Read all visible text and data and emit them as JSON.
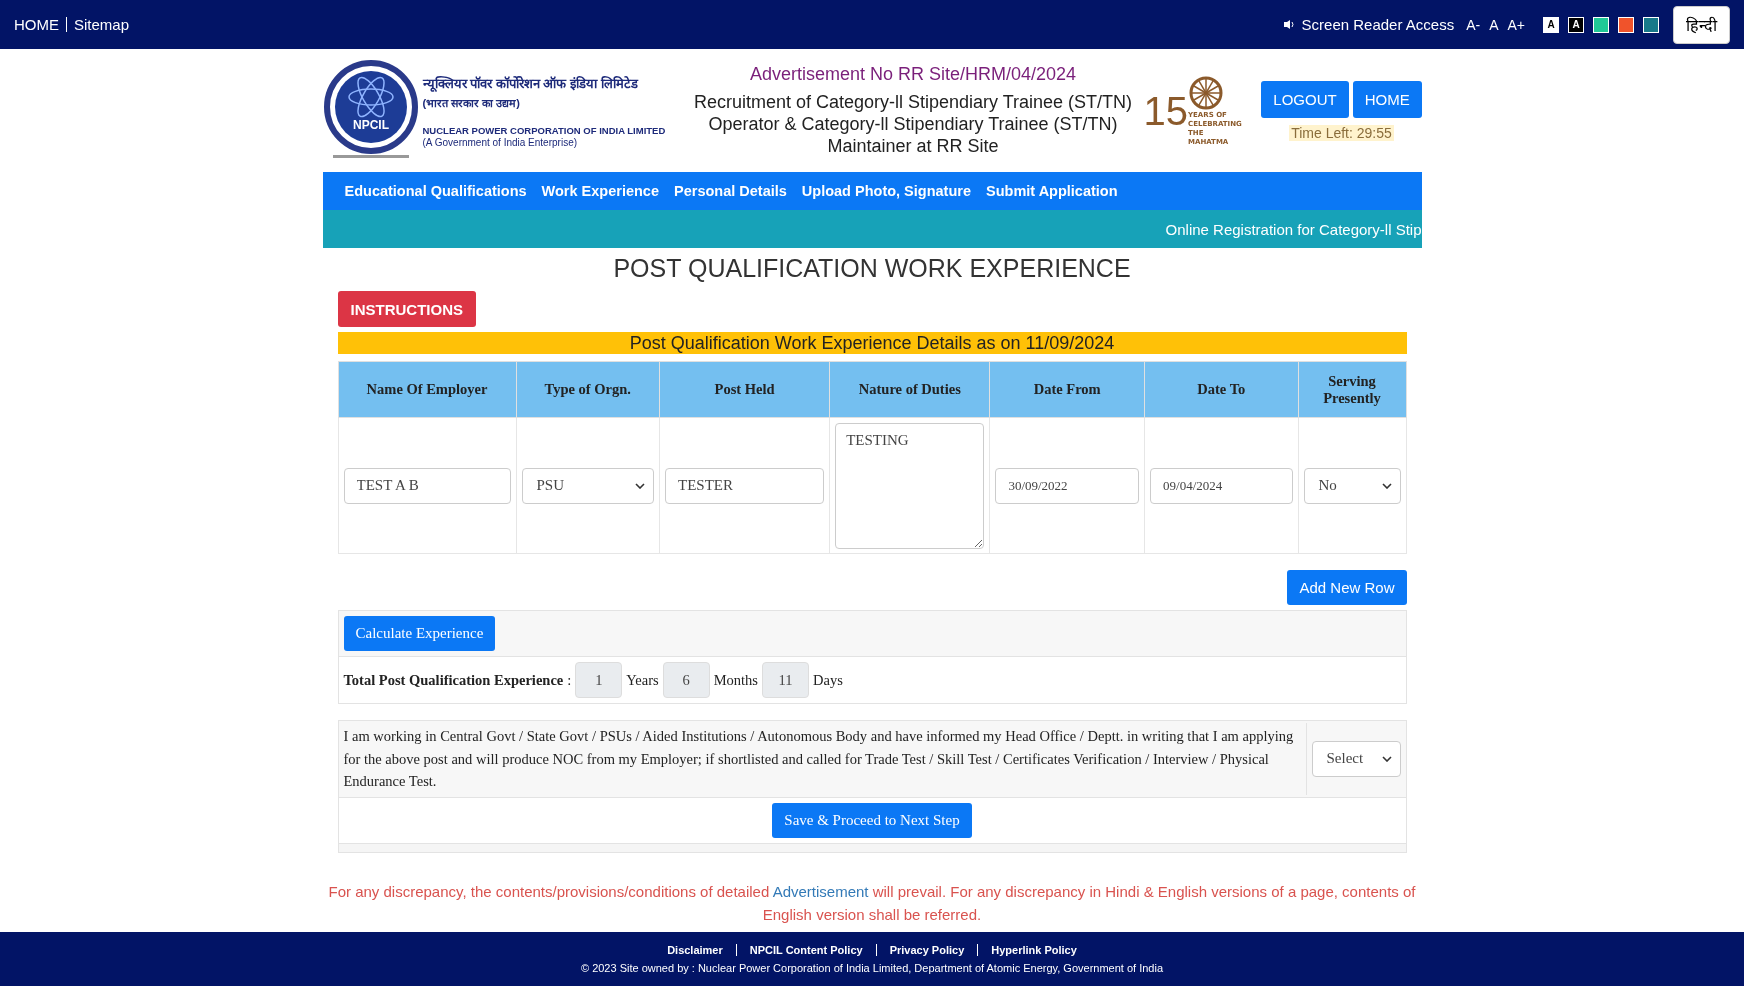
{
  "top_bar": {
    "links": [
      "HOME",
      "Sitemap"
    ],
    "screen_reader": "Screen Reader Access",
    "font_sizes": [
      "A-",
      "A",
      "A+"
    ],
    "themes": [
      {
        "label": "A",
        "color": "#ffffff"
      },
      {
        "label": "A",
        "color": "#000000"
      },
      {
        "color": "#20c997"
      },
      {
        "color": "#f0532b"
      },
      {
        "color": "#17798a"
      }
    ],
    "language": "हिन्दी"
  },
  "header": {
    "logo_text": "NPCIL",
    "org_hindi": "न्यूक्लियर पॉवर कॉर्पोरेशन ऑफ इंडिया लिमिटेड",
    "org_hindi_sub": "(भारत सरकार का उद्यम)",
    "org_english": "NUCLEAR POWER CORPORATION OF INDIA LIMITED",
    "org_english_sub": "(A Government of India Enterprise)",
    "advertisement": "Advertisement No RR Site/HRM/04/2024",
    "recruitment_lines": [
      "Recruitment of Category-ll Stipendiary Trainee (ST/TN)",
      "Operator & Category-ll Stipendiary Trainee (ST/TN)",
      "Maintainer at RR Site"
    ],
    "anniversary_number": "15",
    "anniversary_text": "YEARS OF CELEBRATING THE MAHATMA",
    "buttons": [
      "LOGOUT",
      "HOME"
    ],
    "time_left": "Time Left: 29:55"
  },
  "nav": [
    "Educational Qualifications",
    "Work Experience",
    "Personal Details",
    "Upload Photo, Signature",
    "Submit Application"
  ],
  "marquee": "Online Registration for Category-ll Stip",
  "page_title": "POST QUALIFICATION WORK EXPERIENCE",
  "instructions_button": "INSTRUCTIONS",
  "details_banner": "Post Qualification Work Experience Details as on 11/09/2024",
  "table": {
    "columns": [
      "Name Of Employer",
      "Type of Orgn.",
      "Post Held",
      "Nature of Duties",
      "Date From",
      "Date To",
      "Serving Presently"
    ],
    "rows": [
      [
        {
          "kind": "input",
          "value": "TEST A B"
        },
        {
          "kind": "select",
          "value": "PSU"
        },
        {
          "kind": "input",
          "value": "TESTER"
        },
        {
          "kind": "textarea",
          "value": "TESTING"
        },
        {
          "kind": "date",
          "value": "30/09/2022"
        },
        {
          "kind": "date",
          "value": "09/04/2024"
        },
        {
          "kind": "select",
          "value": "No"
        }
      ]
    ]
  },
  "add_row_button": "Add New Row",
  "calculate_button": "Calculate Experience",
  "total": {
    "label": "Total Post Qualification Experience",
    "separator": ":",
    "parts": [
      {
        "value": "1",
        "unit": "Years"
      },
      {
        "value": "6",
        "unit": "Months"
      },
      {
        "value": "11",
        "unit": "Days"
      }
    ]
  },
  "declaration": {
    "text": "I am working in Central Govt / State Govt / PSUs / Aided Institutions / Autonomous Body and have informed my Head Office / Deptt. in writing that I am applying for the above post and will produce NOC from my Employer; if shortlisted and called for Trade Test / Skill Test / Certificates Verification / Interview / Physical Endurance Test.",
    "select": "Select"
  },
  "save_button": "Save & Proceed to Next Step",
  "notice": {
    "before": "For any discrepancy, the contents/provisions/conditions of detailed",
    "link": "Advertisement",
    "after": "will prevail. For any discrepancy in Hindi & English versions of a page, contents of English version shall be referred."
  },
  "footer": {
    "links": [
      "Disclaimer",
      "NPCIL Content Policy",
      "Privacy Policy",
      "Hyperlink Policy"
    ],
    "copyright": "© 2023 Site owned by : Nuclear Power Corporation of India Limited, Department of Atomic Energy, Government of India"
  }
}
